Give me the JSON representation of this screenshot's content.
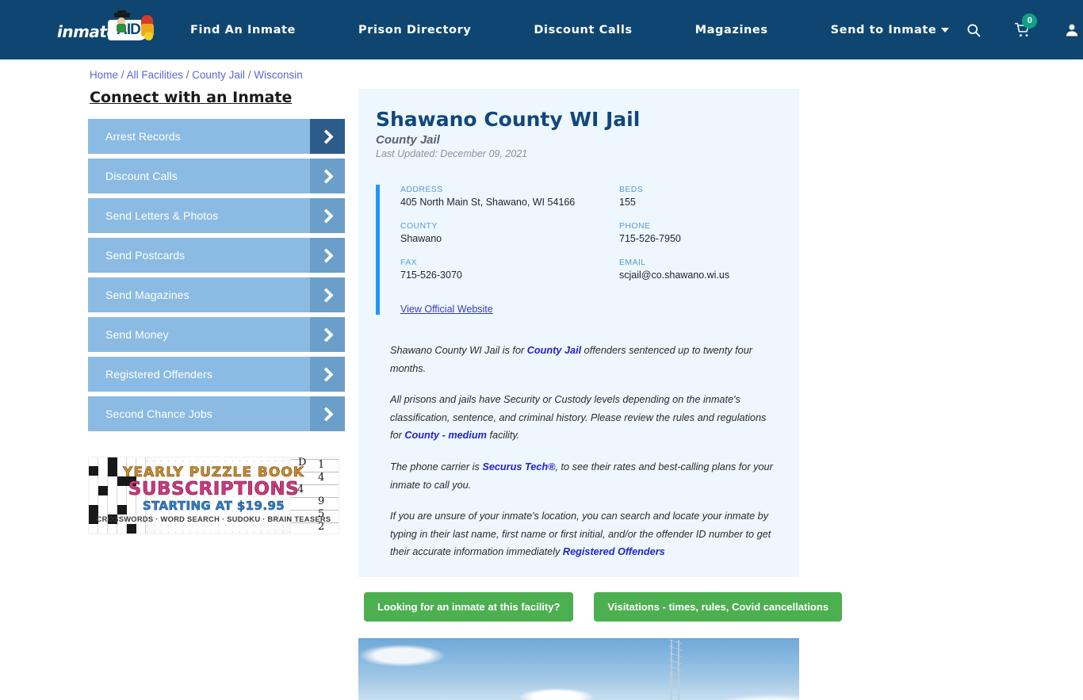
{
  "header": {
    "logo": {
      "text": "inmate",
      "badge": "AID"
    },
    "nav": [
      {
        "label": "Find An Inmate",
        "dropdown": false
      },
      {
        "label": "Prison Directory",
        "dropdown": false
      },
      {
        "label": "Discount Calls",
        "dropdown": false
      },
      {
        "label": "Magazines",
        "dropdown": false
      },
      {
        "label": "Send to Inmate",
        "dropdown": true
      }
    ],
    "icons": {
      "search": "search-icon",
      "cart": "cart-icon",
      "account": "user-icon"
    },
    "cart_count": "0",
    "cart_badge_color": "#13a085",
    "bar_color": "#0f4671"
  },
  "breadcrumb": [
    {
      "label": "Home",
      "link": true
    },
    {
      "label": "All Facilities",
      "link": true
    },
    {
      "label": "County Jail",
      "link": true
    },
    {
      "label": "Wisconsin",
      "link": true
    }
  ],
  "breadcrumb_separator": "/",
  "sidebar": {
    "title": "Connect with an Inmate",
    "items": [
      {
        "label": "Arrest Records",
        "active": true
      },
      {
        "label": "Discount Calls",
        "active": false
      },
      {
        "label": "Send Letters & Photos",
        "active": false
      },
      {
        "label": "Send Postcards",
        "active": false
      },
      {
        "label": "Send Magazines",
        "active": false
      },
      {
        "label": "Send Money",
        "active": false
      },
      {
        "label": "Registered Offenders",
        "active": false
      },
      {
        "label": "Second Chance Jobs",
        "active": false
      }
    ],
    "item_color": "#8bbbe2",
    "arrow_color": "#6b9fc9",
    "arrow_active_color": "#2e5c8a"
  },
  "ad": {
    "line1": "YEARLY PUZZLE BOOK",
    "line2": "SUBSCRIPTIONS",
    "line3": "STARTING AT $19.95",
    "line4": "CROSSWORDS · WORD SEARCH · SUDOKU · BRAIN TEASERS",
    "sudoku_numbers": [
      "1",
      "4",
      "4",
      "9",
      "5",
      "2"
    ]
  },
  "facility": {
    "title": "Shawano County WI Jail",
    "subtitle": "County Jail",
    "last_updated": "Last Updated: December 09, 2021",
    "fields": [
      {
        "label": "ADDRESS",
        "value": "405 North Main St, Shawano, WI 54166"
      },
      {
        "label": "BEDS",
        "value": "155"
      },
      {
        "label": "COUNTY",
        "value": "Shawano"
      },
      {
        "label": "PHONE",
        "value": "715-526-7950"
      },
      {
        "label": "FAX",
        "value": "715-526-3070"
      },
      {
        "label": "EMAIL",
        "value": "scjail@co.shawano.wi.us"
      }
    ],
    "official_website_link": "View Official Website",
    "accent_color": "#2196f3",
    "card_bg": "#edf7fd",
    "paragraphs": [
      [
        {
          "t": "Shawano County WI Jail is for ",
          "link": false
        },
        {
          "t": "County Jail",
          "link": true
        },
        {
          "t": " offenders sentenced up to twenty four months.",
          "link": false
        }
      ],
      [
        {
          "t": "All prisons and jails have Security or Custody levels depending on the inmate's classification, sentence, and criminal history. Please review the rules and regulations for ",
          "link": false
        },
        {
          "t": "County - medium",
          "link": true
        },
        {
          "t": " facility.",
          "link": false
        }
      ],
      [
        {
          "t": "The phone carrier is ",
          "link": false
        },
        {
          "t": "Securus Tech®",
          "link": true
        },
        {
          "t": ", to see their rates and best-calling plans for your inmate to call you.",
          "link": false
        }
      ],
      [
        {
          "t": "If you are unsure of your inmate's location, you can search and locate your inmate by typing in their last name, first name or first initial, and/or the offender ID number to get their accurate information immediately ",
          "link": false
        },
        {
          "t": "Registered Offenders",
          "link": true
        }
      ]
    ]
  },
  "buttons": [
    {
      "label": "Looking for an inmate at this facility?",
      "color": "#4caf50"
    },
    {
      "label": "Visitations - times, rules, Covid cancellations",
      "color": "#4caf50"
    }
  ],
  "photo": {
    "alt": "facility-photo-sky-with-tower"
  }
}
